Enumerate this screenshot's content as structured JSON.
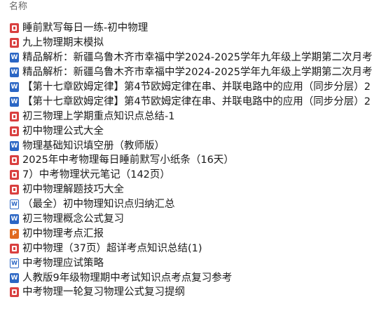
{
  "header": {
    "name_label": "名称"
  },
  "files": [
    {
      "icon": "pdf-icon",
      "type": "pdf",
      "glyph": "",
      "name": "睡前默写每日一练-初中物理"
    },
    {
      "icon": "pdf-icon",
      "type": "pdf",
      "glyph": "",
      "name": "九上物理期末模拟"
    },
    {
      "icon": "word-icon",
      "type": "word",
      "glyph": "W",
      "name": "精品解析：新疆乌鲁木齐市幸福中学2024-2025学年九年级上学期第二次月考"
    },
    {
      "icon": "word-icon",
      "type": "word",
      "glyph": "W",
      "name": "精品解析：新疆乌鲁木齐市幸福中学2024-2025学年九年级上学期第二次月考"
    },
    {
      "icon": "word-icon",
      "type": "word",
      "glyph": "W",
      "name": "【第十七章欧姆定律】第4节欧姆定律在串、并联电路中的应用（同步分层）2"
    },
    {
      "icon": "word-icon",
      "type": "word",
      "glyph": "W",
      "name": "【第十七章欧姆定律】第4节欧姆定律在串、并联电路中的应用（同步分层）2"
    },
    {
      "icon": "pdf-icon",
      "type": "pdf",
      "glyph": "",
      "name": "初三物理上学期重点知识点总结-1"
    },
    {
      "icon": "pdf-icon",
      "type": "pdf",
      "glyph": "",
      "name": "初中物理公式大全"
    },
    {
      "icon": "word-icon",
      "type": "word",
      "glyph": "W",
      "name": "物理基础知识填空册（教师版）"
    },
    {
      "icon": "pdf-icon",
      "type": "pdf",
      "glyph": "",
      "name": "2025年中考物理每日睡前默写小纸条（16天）"
    },
    {
      "icon": "pdf-icon",
      "type": "pdf",
      "glyph": "",
      "name": "7）中考物理状元笔记（142页）"
    },
    {
      "icon": "pdf-icon",
      "type": "pdf",
      "glyph": "",
      "name": "初中物理解题技巧大全"
    },
    {
      "icon": "word-outline-icon",
      "type": "word-outline",
      "glyph": "W",
      "name": "（最全）初中物理知识点归纳汇总"
    },
    {
      "icon": "word-icon",
      "type": "word",
      "glyph": "W",
      "name": "初三物理概念公式复习"
    },
    {
      "icon": "ppt-icon",
      "type": "ppt",
      "glyph": "P",
      "name": "初中物理考点汇报"
    },
    {
      "icon": "pdf-icon",
      "type": "pdf",
      "glyph": "",
      "name": "初中物理（37页）超详考点知识总结(1)"
    },
    {
      "icon": "word-outline-icon",
      "type": "word-outline",
      "glyph": "W",
      "name": "中考物理应试策略"
    },
    {
      "icon": "word-icon",
      "type": "word",
      "glyph": "W",
      "name": "人教版9年级物理期中考试知识点考点复习参考"
    },
    {
      "icon": "pdf-icon",
      "type": "pdf",
      "glyph": "",
      "name": "中考物理一轮复习物理公式复习提纲"
    }
  ]
}
